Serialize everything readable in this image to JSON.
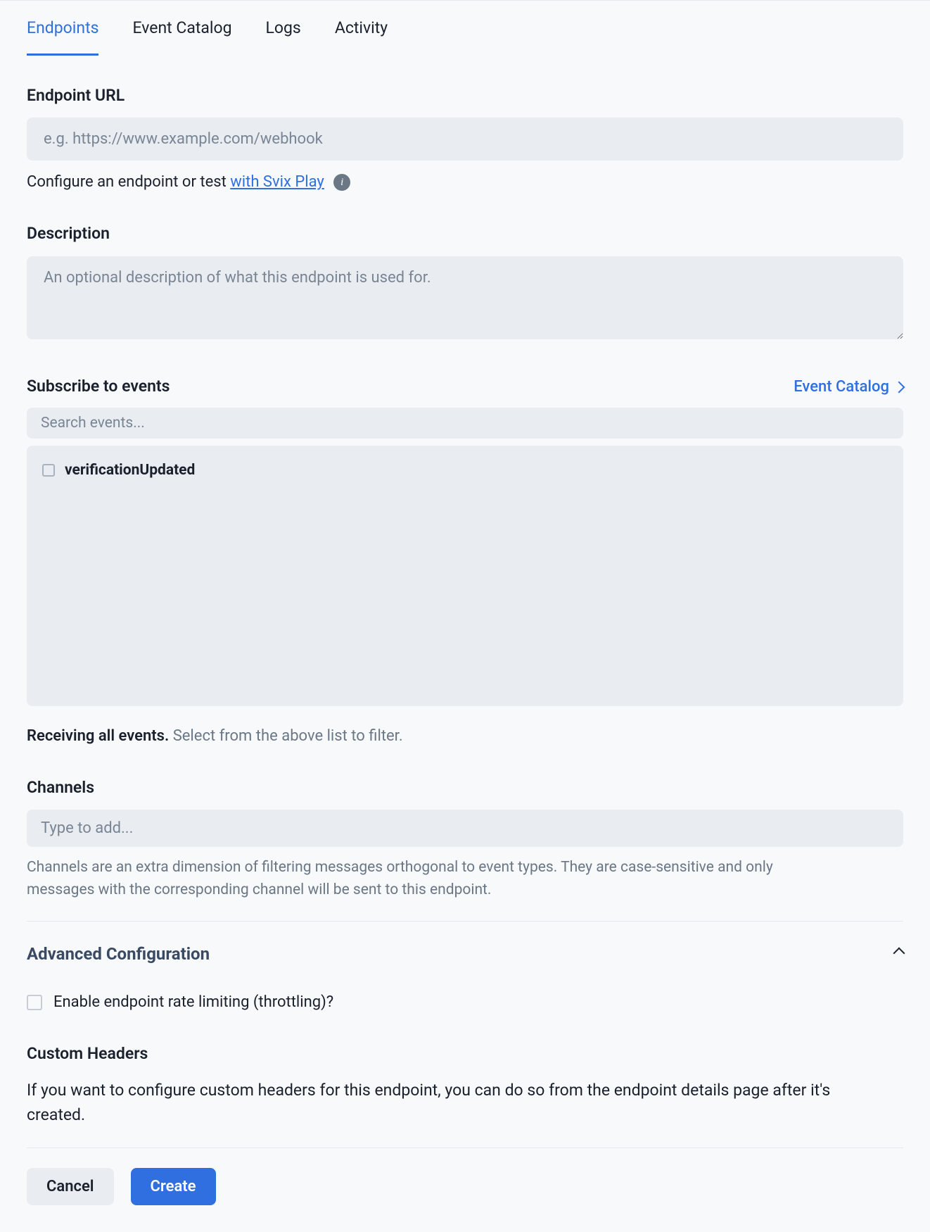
{
  "tabs": [
    {
      "label": "Endpoints",
      "active": true
    },
    {
      "label": "Event Catalog",
      "active": false
    },
    {
      "label": "Logs",
      "active": false
    },
    {
      "label": "Activity",
      "active": false
    }
  ],
  "endpoint_url": {
    "label": "Endpoint URL",
    "placeholder": "e.g. https://www.example.com/webhook",
    "value": "",
    "helper_prefix": "Configure an endpoint or test ",
    "helper_link": "with Svix Play",
    "info_icon": "info-icon"
  },
  "description": {
    "label": "Description",
    "placeholder": "An optional description of what this endpoint is used for.",
    "value": ""
  },
  "events": {
    "label": "Subscribe to events",
    "catalog_link": "Event Catalog",
    "search_placeholder": "Search events...",
    "items": [
      {
        "name": "verificationUpdated",
        "checked": false
      }
    ],
    "status_strong": "Receiving all events.",
    "status_muted": "Select from the above list to filter."
  },
  "channels": {
    "label": "Channels",
    "placeholder": "Type to add...",
    "value": "",
    "help": "Channels are an extra dimension of filtering messages orthogonal to event types. They are case-sensitive and only messages with the corresponding channel will be sent to this endpoint."
  },
  "advanced": {
    "title": "Advanced Configuration",
    "expanded": true,
    "rate_limit": {
      "label": "Enable endpoint rate limiting (throttling)?",
      "checked": false
    },
    "custom_headers": {
      "title": "Custom Headers",
      "desc": "If you want to configure custom headers for this endpoint, you can do so from the endpoint details page after it's created."
    }
  },
  "actions": {
    "cancel": "Cancel",
    "create": "Create"
  }
}
